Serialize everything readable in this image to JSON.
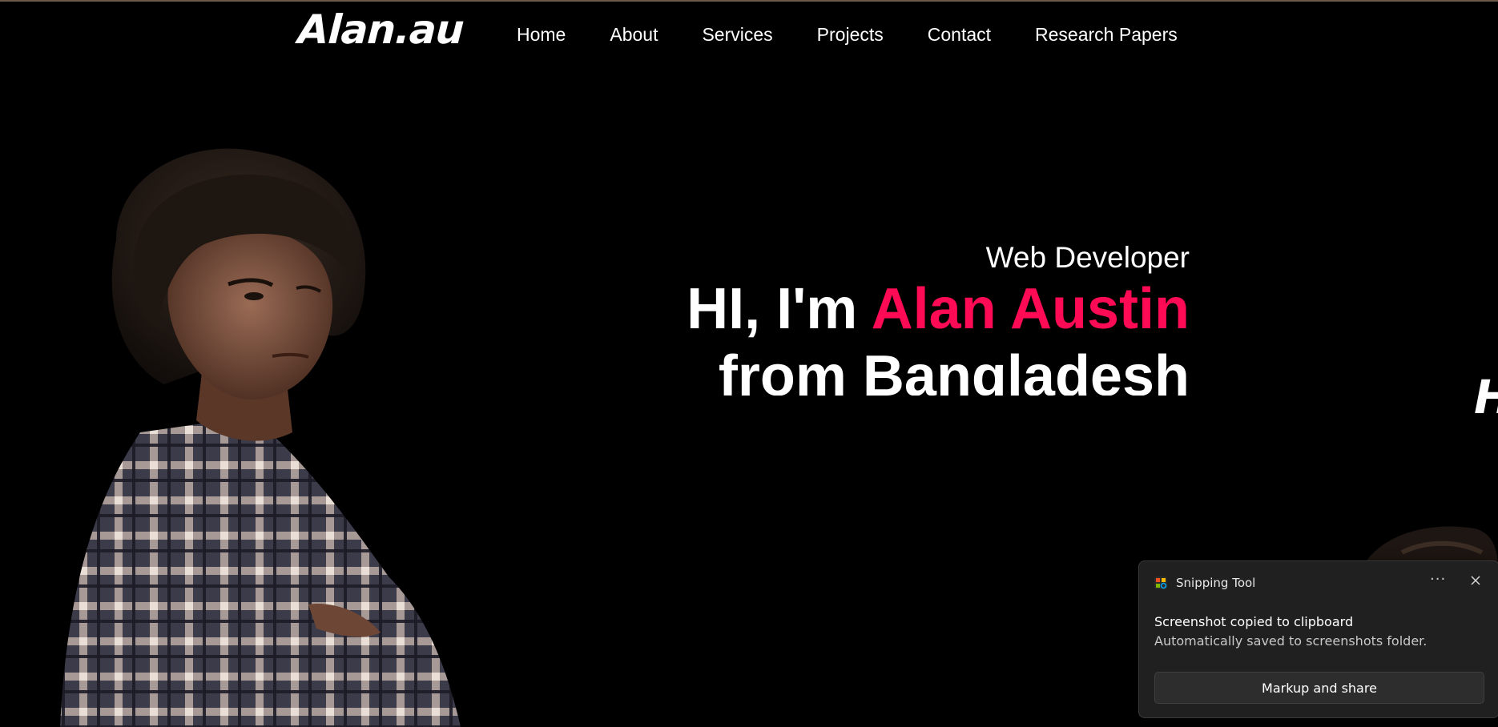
{
  "site": {
    "logo": "Alan.au"
  },
  "nav": {
    "items": [
      {
        "label": "Home"
      },
      {
        "label": "About"
      },
      {
        "label": "Services"
      },
      {
        "label": "Projects"
      },
      {
        "label": "Contact"
      },
      {
        "label": "Research Papers"
      }
    ]
  },
  "hero": {
    "subtitle": "Web Developer",
    "greeting": "HI, I'm ",
    "name": "Alan Austin",
    "line2": "from Bangladesh",
    "side_glyph": "H"
  },
  "toast": {
    "app_name": "Snipping Tool",
    "more_label": "···",
    "title": "Screenshot copied to clipboard",
    "body": "Automatically saved to screenshots folder.",
    "button_label": "Markup and share"
  },
  "colors": {
    "background": "#000000",
    "accent": "#ff0b55",
    "text": "#ffffff",
    "toast_bg": "#202020"
  },
  "icons": {
    "toast_app_icon": "snipping-tool-icon",
    "toast_close": "close-icon",
    "toast_more": "more-options-icon"
  }
}
